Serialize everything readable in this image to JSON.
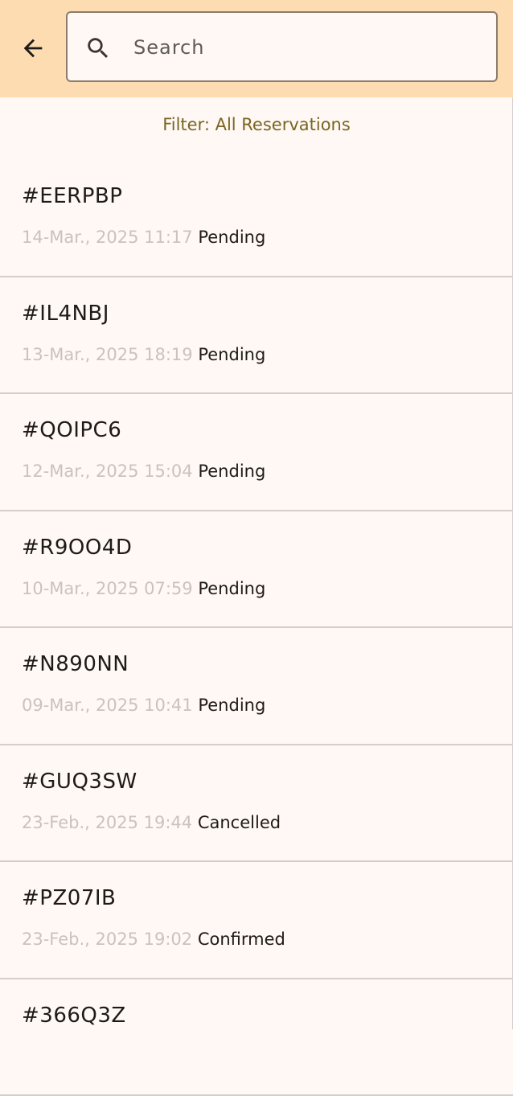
{
  "header": {
    "search_placeholder": "Search"
  },
  "filter": {
    "label": "Filter: All Reservations"
  },
  "reservations": [
    {
      "code": "#EERPBP",
      "date": "14-Mar., 2025 11:17",
      "status": "Pending"
    },
    {
      "code": "#IL4NBJ",
      "date": "13-Mar., 2025 18:19",
      "status": "Pending"
    },
    {
      "code": "#QOIPC6",
      "date": "12-Mar., 2025 15:04",
      "status": "Pending"
    },
    {
      "code": "#R9OO4D",
      "date": "10-Mar., 2025 07:59",
      "status": "Pending"
    },
    {
      "code": "#N890NN",
      "date": "09-Mar., 2025 10:41",
      "status": "Pending"
    },
    {
      "code": "#GUQ3SW",
      "date": "23-Feb., 2025 19:44",
      "status": "Cancelled"
    },
    {
      "code": "#PZ07IB",
      "date": "23-Feb., 2025 19:02",
      "status": "Confirmed"
    },
    {
      "code": "#366Q3Z",
      "date": "",
      "status": ""
    }
  ],
  "colors": {
    "header_bg": "#fcdcb0",
    "page_bg": "#fff8f4",
    "filter_text": "#7a6521",
    "date_text": "#c9c3c0"
  },
  "icons": {
    "back": "arrow-left-icon",
    "search": "search-icon"
  }
}
